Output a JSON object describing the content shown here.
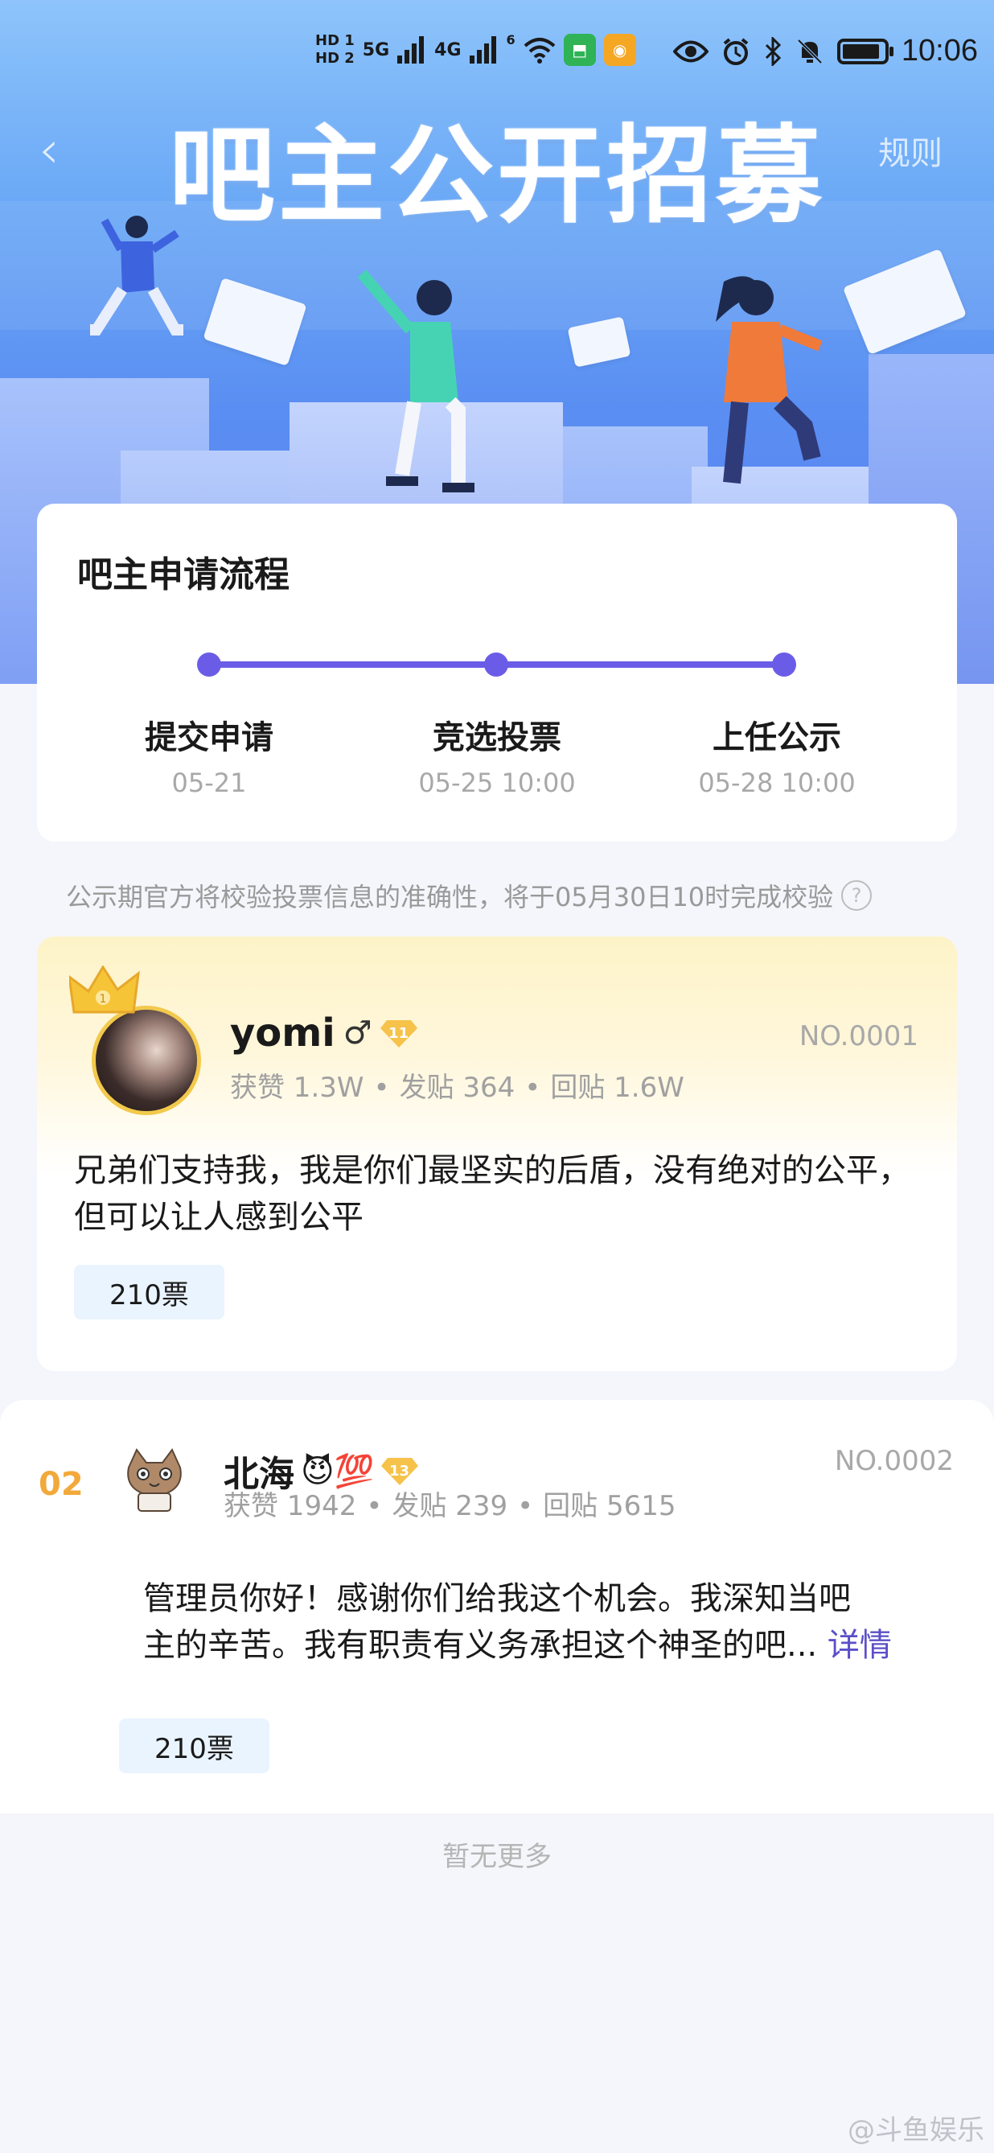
{
  "status": {
    "hd1": "HD 1",
    "hd2": "HD 2",
    "net1": "5G",
    "net2": "4G",
    "wifi_badge": "6",
    "time": "10:06",
    "battery_level": 0.9
  },
  "header": {
    "title": "吧主公开招募",
    "rules_label": "规则"
  },
  "process": {
    "title": "吧主申请流程",
    "steps": [
      {
        "label": "提交申请",
        "date": "05-21"
      },
      {
        "label": "竞选投票",
        "date": "05-25 10:00"
      },
      {
        "label": "上任公示",
        "date": "05-28 10:00"
      }
    ]
  },
  "notice": {
    "text": "公示期官方将校验投票信息的准确性，将于05月30日10时完成校验",
    "help_icon": "?"
  },
  "candidates": [
    {
      "name": "yomi",
      "gender": "♂",
      "level": "11",
      "number": "NO.0001",
      "likes": "获赞 1.3W",
      "posts": "发贴 364",
      "replies": "回贴 1.6W",
      "sep": "•",
      "declaration": "兄弟们支持我，我是你们最坚实的后盾，没有绝对的公平，但可以让人感到公平",
      "votes": "210票"
    },
    {
      "rank": "02",
      "name": "北海",
      "emoji": "😈💯",
      "level": "13",
      "number": "NO.0002",
      "likes": "获赞 1942",
      "posts": "发贴 239",
      "replies": "回贴 5615",
      "sep": "•",
      "declaration_line1": "管理员你好！感谢你们给我这个机会。我深知当吧",
      "declaration_line2": "主的辛苦。我有职责有义务承担这个神圣的吧...",
      "more_label": "详情",
      "votes": "210票"
    }
  ],
  "footer": {
    "no_more": "暂无更多",
    "watermark": "@斗鱼娱乐"
  },
  "colors": {
    "accent": "#6b5ce7",
    "rank": "#f2a93b",
    "vote_bg": "#eaf4ff"
  }
}
